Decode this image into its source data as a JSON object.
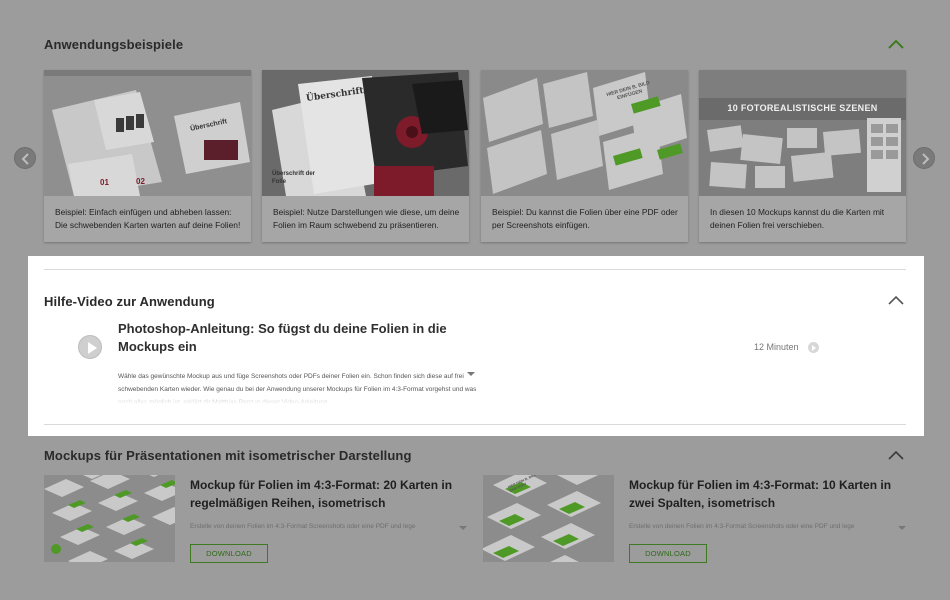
{
  "colors": {
    "accent": "#4f9a27",
    "panel_bg": "#ffffff",
    "dim_bg": "#9c9c9c"
  },
  "examples": {
    "title": "Anwendungsbeispiele",
    "cards": [
      {
        "thumb_text": [
          "01",
          "02",
          "Überschrift"
        ],
        "caption": "Beispiel: Einfach einfügen und abheben lassen: Die schwebenden Karten warten auf deine Folien!"
      },
      {
        "thumb_text": [
          "Überschrift",
          "Überschrift der Folie"
        ],
        "caption": "Beispiel: Nutze Darstellungen wie diese, um deine Folien im Raum schwebend zu präsentieren."
      },
      {
        "thumb_text": [
          "HIER DEIN B. BILD EINFÜGEN"
        ],
        "caption": "Beispiel: Du kannst die Folien über eine PDF oder per Screenshots einfügen."
      },
      {
        "thumb_text": [
          "10 FOTOREALISTISCHE SZENEN"
        ],
        "caption": "In diesen 10 Mockups kannst du die Karten mit deinen Folien frei verschieben."
      }
    ]
  },
  "help": {
    "title": "Hilfe-Video zur Anwendung",
    "video_title": "Photoshop-Anleitung: So fügst du deine Folien in die Mockups ein",
    "duration": "12 Minuten",
    "description": "Wähle das gewünschte Mockup aus und füge Screenshots oder PDFs deiner Folien ein. Schon finden sich diese auf frei schwebenden Karten wieder. Wie genau du bei der Anwendung unserer Mockups für Folien im 4:3-Format vorgehst und was noch alles möglich ist, erklärt dir Matthias Penz in dieser Video-Anleitung."
  },
  "iso": {
    "title": "Mockups für Präsentationen mit isometrischer Darstellung",
    "products": [
      {
        "title": "Mockup für Folien im 4:3-Format: 20 Karten in regelmäßigen Reihen, isometrisch",
        "desc": "Erstelle von deinen Folien im 4:3-Format Screenshots oder eine PDF und lege",
        "button": "DOWNLOAD",
        "thumb_text": "HIER DEIN B. BILD EINFÜGEN"
      },
      {
        "title": "Mockup für Folien im 4:3-Format: 10 Karten in zwei Spalten, isometrisch",
        "desc": "Erstelle von deinen Folien im 4:3-Format Screenshots oder eine PDF und lege",
        "button": "DOWNLOAD",
        "thumb_text": "HIER DEIN B. BILD EINFÜGEN"
      }
    ]
  }
}
